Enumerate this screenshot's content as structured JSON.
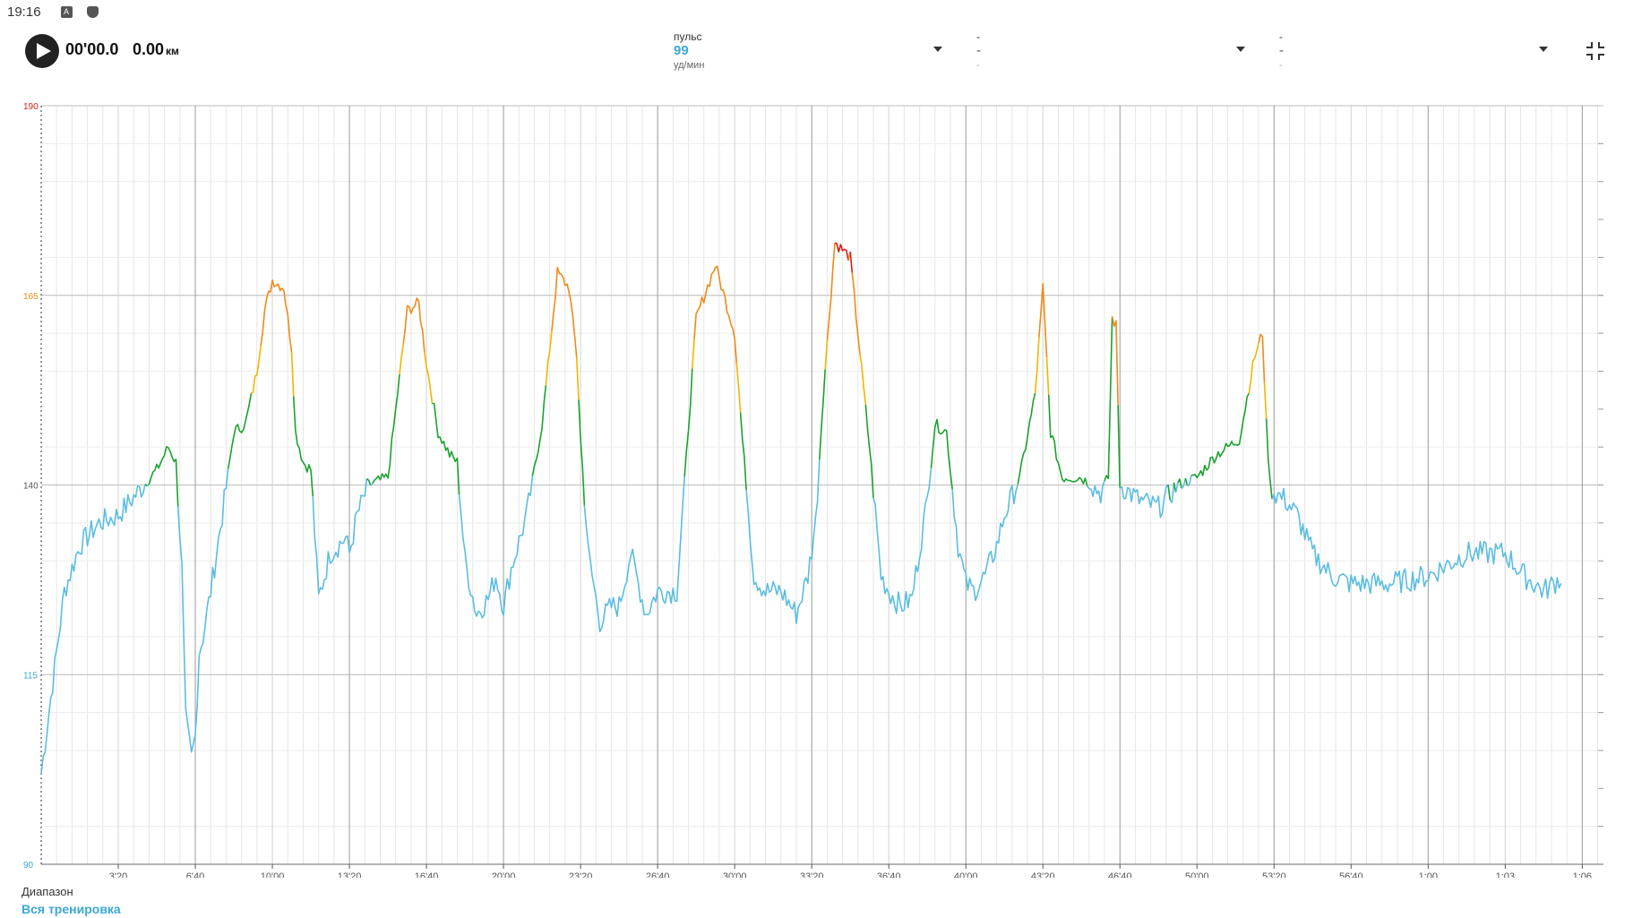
{
  "status_bar": {
    "time": "19:16",
    "icons": [
      "notification-a-icon",
      "shield-icon"
    ]
  },
  "player": {
    "elapsed": "00'00.0",
    "distance": "0.00",
    "distance_unit": "км"
  },
  "metrics": [
    {
      "label": "пульс",
      "value": "99",
      "unit": "уд/мин"
    },
    {
      "label": "-",
      "value": "-",
      "unit": "-"
    },
    {
      "label": "-",
      "value": "-",
      "unit": "-"
    }
  ],
  "range": {
    "label": "Диапазон",
    "value": "Вся тренировка"
  },
  "colors": {
    "accent": "#3aa8d8",
    "zone_low": "#5bbde0",
    "zone_green": "#1aa22e",
    "zone_yellow": "#f5b400",
    "zone_orange": "#f08a18",
    "zone_red": "#d81e1e"
  },
  "chart_data": {
    "type": "line",
    "title": "",
    "xlabel": "",
    "ylabel": "",
    "y_tick_labels": [
      {
        "label": "190",
        "value": 190,
        "color": "#d81e1e"
      },
      {
        "label": "165",
        "value": 165,
        "color": "#f08a18"
      },
      {
        "label": "140",
        "value": 140,
        "color": "#555555"
      },
      {
        "label": "115",
        "value": 115,
        "color": "#3aa8d8"
      },
      {
        "label": "90",
        "value": 90,
        "color": "#3aa8d8"
      }
    ],
    "ylim": [
      90,
      190
    ],
    "x_tick_labels": [
      "3'20",
      "6'40",
      "10'00",
      "13'20",
      "16'40",
      "20'00",
      "23'20",
      "26'40",
      "30'00",
      "33'20",
      "36'40",
      "40'00",
      "43'20",
      "46'40",
      "50'00",
      "53'20",
      "56'40",
      "1:00",
      "1:03",
      "1:06"
    ],
    "x_tick_seconds": [
      200,
      400,
      600,
      800,
      1000,
      1200,
      1400,
      1600,
      1800,
      2000,
      2200,
      2400,
      2600,
      2800,
      3000,
      3200,
      3400,
      3600,
      3800,
      4000
    ],
    "xlim_seconds": [
      0,
      4055
    ],
    "grid": true,
    "series": [
      {
        "x_seconds": [
          0,
          30,
          60,
          100,
          150,
          200,
          250,
          300,
          330,
          350,
          365,
          375,
          390,
          400,
          410,
          420,
          440,
          470,
          500,
          530,
          560,
          580,
          600,
          630,
          650,
          660,
          670,
          680,
          700,
          720,
          750,
          770,
          790,
          800,
          820,
          850,
          900,
          950,
          980,
          1000,
          1030,
          1060,
          1080,
          1100,
          1130,
          1160,
          1180,
          1200,
          1220,
          1260,
          1300,
          1340,
          1370,
          1390,
          1400,
          1420,
          1450,
          1480,
          1500,
          1530,
          1570,
          1600,
          1650,
          1700,
          1750,
          1800,
          1820,
          1850,
          1880,
          1920,
          1960,
          1990,
          2010,
          2030,
          2060,
          2100,
          2150,
          2180,
          2200,
          2230,
          2260,
          2300,
          2320,
          2350,
          2380,
          2400,
          2420,
          2450,
          2480,
          2500,
          2540,
          2580,
          2600,
          2620,
          2650,
          2700,
          2750,
          2760,
          2770,
          2780,
          2790,
          2800,
          2850,
          2900,
          2950,
          3000,
          3050,
          3080,
          3110,
          3150,
          3170,
          3180,
          3190,
          3200,
          3230,
          3260,
          3300,
          3350,
          3400,
          3500,
          3600,
          3700,
          3800,
          3850,
          3900,
          3950,
          4000,
          4055
        ],
        "y_values": [
          102,
          114,
          126,
          132,
          135,
          136,
          139,
          142,
          145,
          143,
          129,
          109,
          104,
          107,
          118,
          120,
          126,
          136,
          147,
          148,
          155,
          163,
          167,
          166,
          158,
          147,
          145,
          143,
          142,
          125,
          131,
          132,
          133,
          131,
          136,
          140,
          141,
          163,
          164,
          156,
          147,
          144,
          143,
          130,
          123,
          125,
          128,
          124,
          129,
          136,
          148,
          168,
          166,
          157,
          146,
          131,
          122,
          124,
          124,
          131,
          123,
          126,
          126,
          162,
          169,
          160,
          146,
          128,
          126,
          126,
          123,
          128,
          135,
          152,
          172,
          170,
          145,
          128,
          126,
          124,
          125,
          138,
          148,
          147,
          132,
          127,
          126,
          128,
          132,
          136,
          141,
          152,
          166,
          147,
          141,
          141,
          139,
          140,
          141,
          162,
          161,
          140,
          138,
          137,
          140,
          141,
          144,
          145,
          146,
          157,
          160,
          148,
          140,
          139,
          138,
          136,
          131,
          128,
          127,
          127,
          128,
          131,
          131,
          128,
          126,
          128
        ]
      }
    ]
  }
}
